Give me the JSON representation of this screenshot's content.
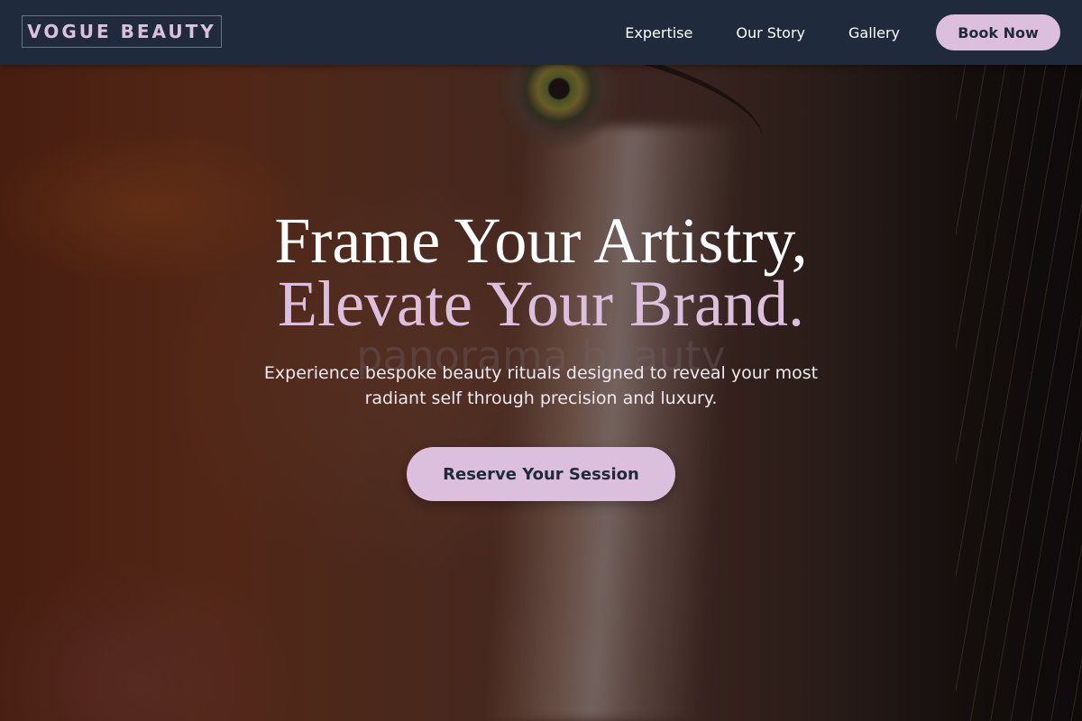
{
  "brand": {
    "name": "VOGUE BEAUTY"
  },
  "nav": {
    "links": [
      "Expertise",
      "Our Story",
      "Gallery"
    ],
    "cta_label": "Book Now"
  },
  "hero": {
    "headline_line1": "Frame Your Artistry,",
    "headline_line2": "Elevate Your Brand.",
    "watermark": "panorama beauty",
    "subtitle": "Experience bespoke beauty rituals designed to reveal your most radiant self through precision and luxury.",
    "cta_label": "Reserve Your Session"
  },
  "colors": {
    "nav_bg": "#1f2a3c",
    "accent": "#dcbfdc",
    "text_light": "#ffffff"
  }
}
